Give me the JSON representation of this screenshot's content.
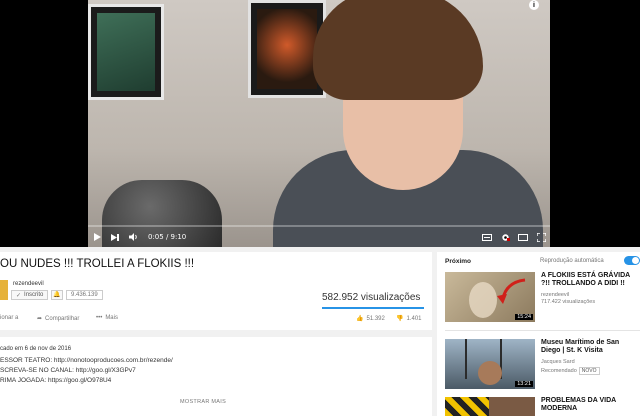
{
  "player": {
    "time": "0:05 / 9:10",
    "info": "i"
  },
  "video": {
    "title": "OU NUDES !!! TROLLEI A FLOKIIS !!!",
    "channel": "rezendeevil",
    "subscribe_label": "Inscrito",
    "subscriber_count": "9.436.139",
    "views": "582.952 visualizações",
    "actions": {
      "add_to": "ionar a",
      "share": "Compartilhar",
      "more": "Mais",
      "likes": "51.392",
      "dislikes": "1.401"
    }
  },
  "description": {
    "date": "cado em 6 de nov de 2016",
    "lines": [
      "ESSOR TEATRO: http://nonotooproducoes.com.br/rezende/",
      "SCREVA-SE NO CANAL: http://goo.gl/X3GPv7",
      "RIMA JOGADA: https://goo.gl/O978U4"
    ],
    "more_label": "MOSTRAR MAIS"
  },
  "sidebar": {
    "next_label": "Próximo",
    "autoplay_label": "Reprodução automática",
    "items": [
      {
        "title": "A FLOKIIS ESTÁ GRÁVIDA ?!! TROLLANDO A DIDI !!",
        "channel": "rezendeevil",
        "views": "717.422 visualizações",
        "duration": "15:24"
      },
      {
        "title": "Museu Marítimo de San Diego | St. K Visita",
        "channel": "Jacques Sard",
        "badge": "NOVO",
        "meta": "Recomendado",
        "duration": "13:21"
      },
      {
        "title": "PROBLEMAS DA VIDA MODERNA",
        "channel": "",
        "duration": ""
      }
    ]
  },
  "colors": {
    "accent_blue": "#2793e6",
    "background": "#f1f1f1",
    "player": "#000000"
  }
}
